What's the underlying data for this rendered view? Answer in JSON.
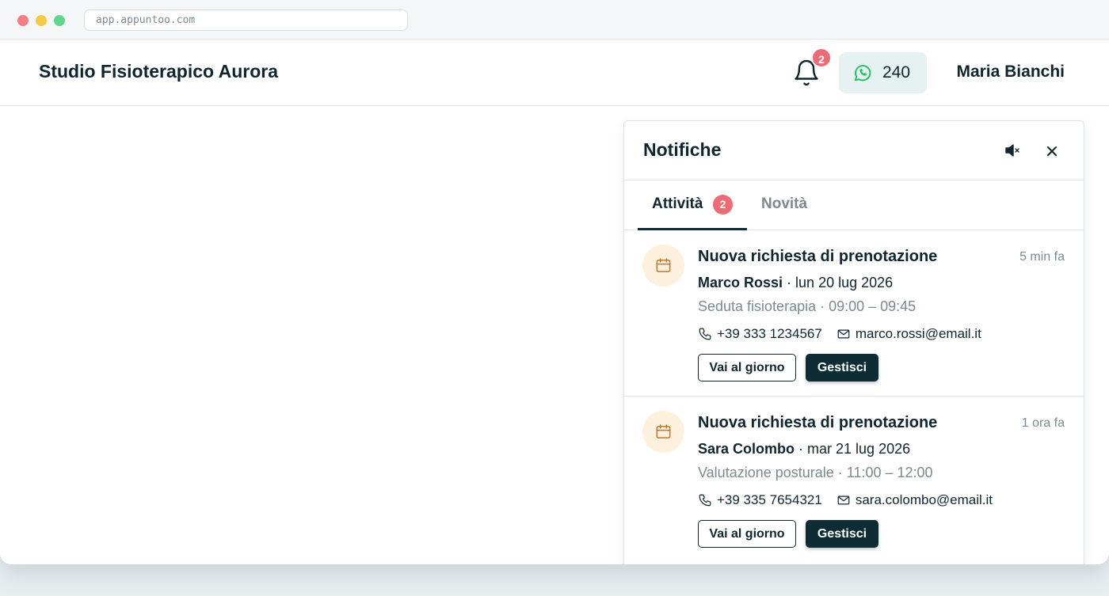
{
  "browser": {
    "url": "app.appuntoo.com"
  },
  "header": {
    "studio_name": "Studio Fisioterapico Aurora",
    "notification_count": "2",
    "whatsapp_credits": "240",
    "user_name": "Maria Bianchi"
  },
  "panel": {
    "title": "Notifiche",
    "tabs": [
      {
        "label": "Attività",
        "badge": "2",
        "active": true
      },
      {
        "label": "Novità",
        "active": false
      }
    ],
    "notifications": [
      {
        "title": "Nuova richiesta di prenotazione",
        "time": "5 min fa",
        "person": "Marco Rossi",
        "date": " · lun 20 lug 2026",
        "service": "Seduta fisioterapia · 09:00 – 09:45",
        "phone": "+39 333 1234567",
        "email": "marco.rossi@email.it",
        "btn_day": "Vai al giorno",
        "btn_manage": "Gestisci"
      },
      {
        "title": "Nuova richiesta di prenotazione",
        "time": "1 ora fa",
        "person": "Sara Colombo",
        "date": " · mar 21 lug 2026",
        "service": "Valutazione posturale · 11:00 – 12:00",
        "phone": "+39 335 7654321",
        "email": "sara.colombo@email.it",
        "btn_day": "Vai al giorno",
        "btn_manage": "Gestisci"
      }
    ]
  },
  "colors": {
    "accent_dark": "#0e2c33",
    "badge_red": "#ec6b74",
    "whatsapp_green": "#25c164",
    "calendar_bg": "#fdf0dc",
    "calendar_stroke": "#c27a2a"
  }
}
